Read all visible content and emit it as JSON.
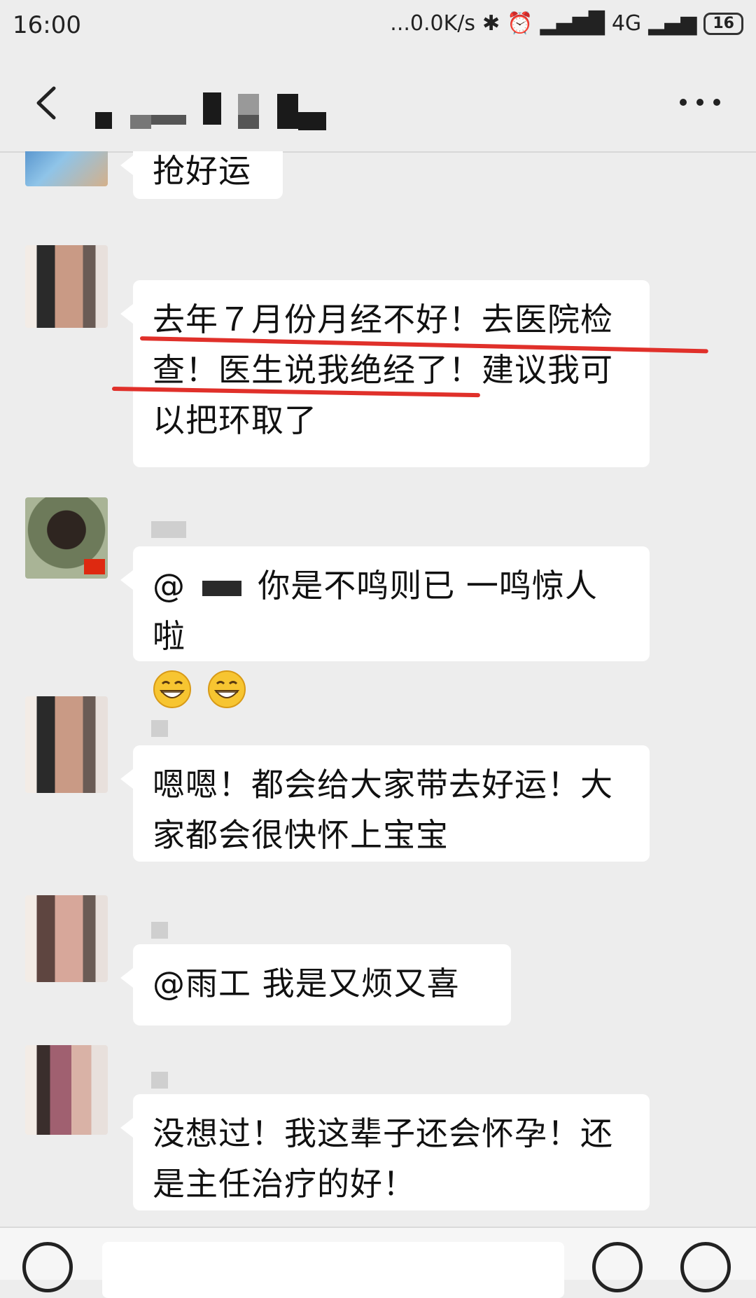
{
  "status_bar": {
    "time": "16:00",
    "network_speed": "...0.0K/s",
    "network_type": "4G",
    "battery": "16"
  },
  "header": {
    "back_icon": "chevron-left-icon",
    "more_icon": "more-dots-icon",
    "title": ""
  },
  "messages": [
    {
      "text": "抢好运"
    },
    {
      "text_lines": [
        "去年７月份月经不好！去医院检",
        "查！医生说我绝经了！建议我可",
        "以把环取了"
      ]
    },
    {
      "mention": "@",
      "text": "你是不鸣则已 一鸣惊人啦",
      "emojis": [
        "grin-emoji",
        "grin-emoji"
      ]
    },
    {
      "text_lines": [
        "嗯嗯！都会给大家带去好运！大",
        "家都会很快怀上宝宝"
      ]
    },
    {
      "text": "@雨工  我是又烦又喜"
    },
    {
      "text_lines": [
        "没想过！我这辈子还会怀孕！还",
        "是主任治疗的好！"
      ]
    }
  ],
  "colors": {
    "background": "#ededed",
    "bubble": "#ffffff",
    "annotation_underline": "#e0302a"
  }
}
